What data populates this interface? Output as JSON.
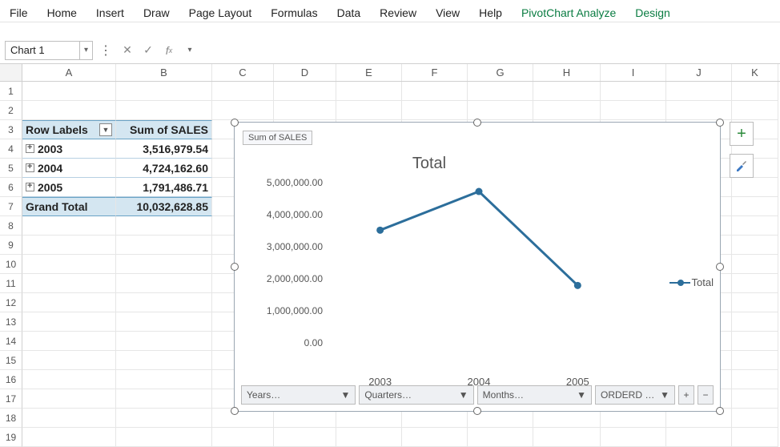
{
  "ribbon": {
    "tabs": [
      "File",
      "Home",
      "Insert",
      "Draw",
      "Page Layout",
      "Formulas",
      "Data",
      "Review",
      "View",
      "Help"
    ],
    "context_tabs": [
      "PivotChart Analyze",
      "Design"
    ]
  },
  "name_box": {
    "value": "Chart 1"
  },
  "formula_bar": {
    "value": ""
  },
  "columns": [
    "A",
    "B",
    "C",
    "D",
    "E",
    "F",
    "G",
    "H",
    "I",
    "J",
    "K"
  ],
  "row_numbers": [
    "1",
    "2",
    "3",
    "4",
    "5",
    "6",
    "7",
    "8",
    "9",
    "10",
    "11",
    "12",
    "13",
    "14",
    "15",
    "16",
    "17",
    "18",
    "19"
  ],
  "pivot_table": {
    "header_a": "Row Labels",
    "header_b": "Sum of SALES",
    "rows": [
      {
        "label": "2003",
        "value": "3,516,979.54"
      },
      {
        "label": "2004",
        "value": "4,724,162.60"
      },
      {
        "label": "2005",
        "value": "1,791,486.71"
      }
    ],
    "total_label": "Grand Total",
    "total_value": "10,032,628.85"
  },
  "chart_data": {
    "type": "line",
    "badge": "Sum of SALES",
    "title": "Total",
    "categories": [
      "2003",
      "2004",
      "2005"
    ],
    "series": [
      {
        "name": "Total",
        "values": [
          3516979.54,
          4724162.6,
          1791486.71
        ],
        "color": "#2c6e9b"
      }
    ],
    "ylim": [
      0,
      5000000
    ],
    "y_ticks": [
      "0.00",
      "1,000,000.00",
      "2,000,000.00",
      "3,000,000.00",
      "4,000,000.00",
      "5,000,000.00"
    ],
    "filters": [
      "Years…",
      "Quarters…",
      "Months…",
      "ORDERD …"
    ]
  },
  "side_buttons": {
    "plus": "+",
    "brush": "brush"
  }
}
